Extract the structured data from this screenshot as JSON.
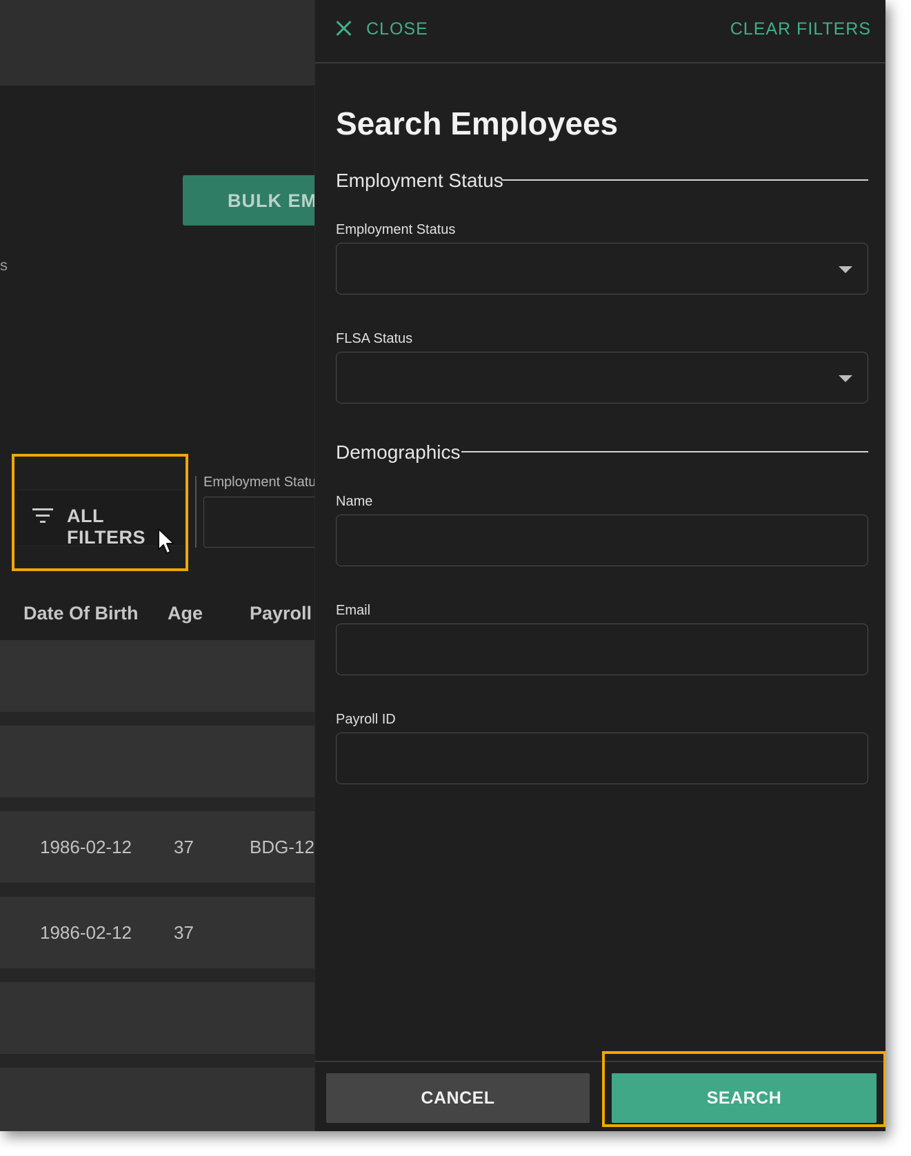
{
  "background": {
    "bulk_button_label": "BULK EMP",
    "stray_char": "s",
    "all_filters_label": "ALL FILTERS",
    "employment_status_label": "Employment Statu",
    "columns": [
      "Date Of Birth",
      "Age",
      "Payroll"
    ],
    "rows": [
      {
        "dob": "1986-02-12",
        "age": "37",
        "payroll": "BDG-12"
      },
      {
        "dob": "1986-02-12",
        "age": "37",
        "payroll": ""
      }
    ]
  },
  "drawer": {
    "close_label": "CLOSE",
    "clear_filters_label": "CLEAR FILTERS",
    "title": "Search Employees",
    "sections": {
      "employment": "Employment Status",
      "demographics": "Demographics"
    },
    "fields": {
      "employment_status": {
        "label": "Employment Status",
        "value": ""
      },
      "flsa_status": {
        "label": "FLSA Status",
        "value": ""
      },
      "name": {
        "label": "Name",
        "value": ""
      },
      "email": {
        "label": "Email",
        "value": ""
      },
      "payroll_id": {
        "label": "Payroll ID",
        "value": ""
      }
    },
    "cancel_label": "CANCEL",
    "search_label": "SEARCH"
  },
  "colors": {
    "accent": "#3fb08a",
    "highlight": "#f0a800",
    "panel": "#1f1f1f"
  }
}
